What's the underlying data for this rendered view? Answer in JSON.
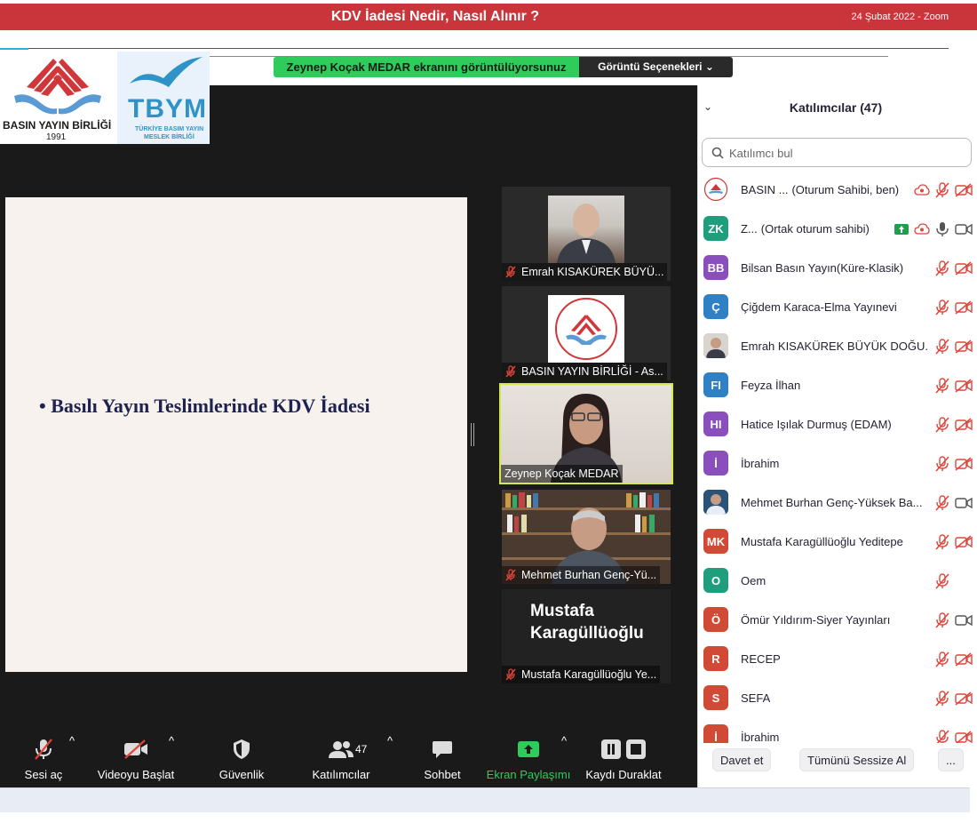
{
  "banner": {
    "title": "KDV İadesi Nedir, Nasıl Alınır ?",
    "date": "24 Şubat 2022 - Zoom"
  },
  "share_bar": {
    "message": "Zeynep Koçak MEDAR ekranını görüntülüyorsunuz",
    "options": "Görüntü Seçenekleri ⌄"
  },
  "logos": {
    "left": {
      "line1": "BASIN YAYIN BİRLİĞİ",
      "line2": "1991"
    },
    "right": {
      "acronym": "TBYM",
      "line1": "TÜRKİYE BASIM YAYIN",
      "line2": "MESLEK BİRLİĞİ"
    }
  },
  "slide": {
    "bullet": "• Basılı Yayın Teslimlerinde KDV İadesi"
  },
  "video_tiles": [
    {
      "name": "Emrah KISAKÜREK BÜYÜ...",
      "muted": true
    },
    {
      "name": "BASIN YAYIN BİRLİĞİ - As...",
      "muted": true
    },
    {
      "name": "Zeynep Koçak MEDAR",
      "muted": false,
      "active": true
    },
    {
      "name": "Mehmet Burhan Genç-Yü...",
      "muted": true
    },
    {
      "name": "Mustafa Karagüllüoğlu Ye...",
      "muted": true,
      "big_line1": "Mustafa",
      "big_line2": "Karagüllüoğlu"
    }
  ],
  "toolbar": {
    "unmute": "Sesi aç",
    "start_video": "Videoyu Başlat",
    "security": "Güvenlik",
    "participants": "Katılımcılar",
    "participants_count": "47",
    "chat": "Sohbet",
    "share": "Ekran Paylaşımı",
    "record": "Kaydı Duraklat"
  },
  "panel": {
    "title": "Katılımcılar (47)",
    "search_placeholder": "Katılımcı bul",
    "invite": "Davet et",
    "mute_all": "Tümünü Sessize Al",
    "more": "..."
  },
  "participants": [
    {
      "initials": "",
      "color": "#ffffff",
      "name": "BASIN ...",
      "extra": "(Oturum Sahibi, ben)",
      "mic": "muted",
      "video": "off",
      "logo": true,
      "cloud": true
    },
    {
      "initials": "ZK",
      "color": "#1f9e7e",
      "name": "Z...",
      "extra": "(Ortak oturum sahibi)",
      "mic": "on",
      "video": "on",
      "cloud": true,
      "share": true
    },
    {
      "initials": "BB",
      "color": "#8a4fbd",
      "name": "Bilsan Basın Yayın(Küre-Klasik)",
      "mic": "muted",
      "video": "off"
    },
    {
      "initials": "Ç",
      "color": "#2f80c4",
      "name": "Çiğdem Karaca-Elma Yayınevi",
      "mic": "muted",
      "video": "off"
    },
    {
      "initials": "",
      "color": "#7d6a5f",
      "name": "Emrah KISAKÜREK BÜYÜK DOĞU...",
      "mic": "muted",
      "video": "off",
      "photo": true
    },
    {
      "initials": "FI",
      "color": "#2f80c4",
      "name": "Feyza İlhan",
      "mic": "muted",
      "video": "off"
    },
    {
      "initials": "HI",
      "color": "#8a4fbd",
      "name": "Hatice Işılak Durmuş (EDAM)",
      "mic": "muted",
      "video": "off"
    },
    {
      "initials": "İ",
      "color": "#8a4fbd",
      "name": "İbrahim",
      "mic": "muted",
      "video": "off"
    },
    {
      "initials": "",
      "color": "#2b5278",
      "name": "Mehmet Burhan Genç-Yüksek Ba...",
      "mic": "muted",
      "video": "on",
      "photo": true
    },
    {
      "initials": "MK",
      "color": "#d04a35",
      "name": "Mustafa Karagüllüoğlu Yeditepe",
      "mic": "muted",
      "video": "off"
    },
    {
      "initials": "O",
      "color": "#1f9e7e",
      "name": "Oem",
      "mic": "muted",
      "video": "none"
    },
    {
      "initials": "Ö",
      "color": "#d04a35",
      "name": "Ömür Yıldırım-Siyer Yayınları",
      "mic": "muted",
      "video": "on"
    },
    {
      "initials": "R",
      "color": "#d04a35",
      "name": "RECEP",
      "mic": "muted",
      "video": "off"
    },
    {
      "initials": "S",
      "color": "#d04a35",
      "name": "SEFA",
      "mic": "muted",
      "video": "off"
    },
    {
      "initials": "İ",
      "color": "#d04a35",
      "name": "İbrahim",
      "mic": "muted",
      "video": "off"
    }
  ]
}
